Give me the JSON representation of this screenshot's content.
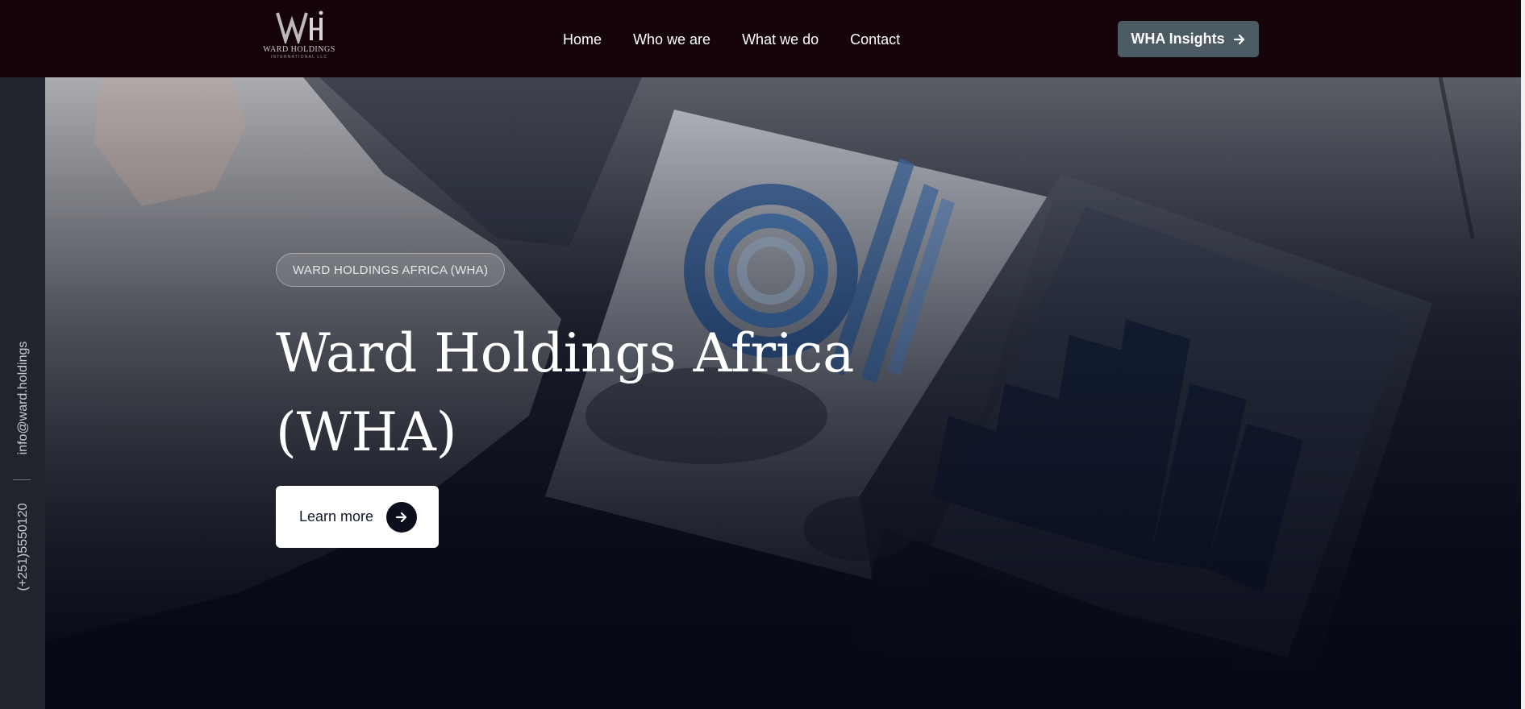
{
  "brand": {
    "logo_mark": "WH",
    "logo_name": "WARD HOLDINGS",
    "logo_sub": "INTERNATIONAL LLC"
  },
  "nav": {
    "items": [
      {
        "label": "Home"
      },
      {
        "label": "Who we are"
      },
      {
        "label": "What we do"
      },
      {
        "label": "Contact"
      }
    ],
    "cta_label": "WHA Insights",
    "cta_icon": "arrow-right-icon"
  },
  "rail": {
    "email": "info@ward.holdings",
    "phone": "(+251)5550120"
  },
  "hero": {
    "badge": "WARD HOLDINGS AFRICA (WHA)",
    "title": "Ward Holdings Africa (WHA)",
    "button_label": "Learn more",
    "button_icon": "arrow-right-circle-icon"
  },
  "colors": {
    "topbar": "#15050b",
    "cta": "#4b5a63",
    "rail": "#20242c",
    "hero_dark": "#060a16",
    "accent_blue": "#1f4f8f"
  }
}
